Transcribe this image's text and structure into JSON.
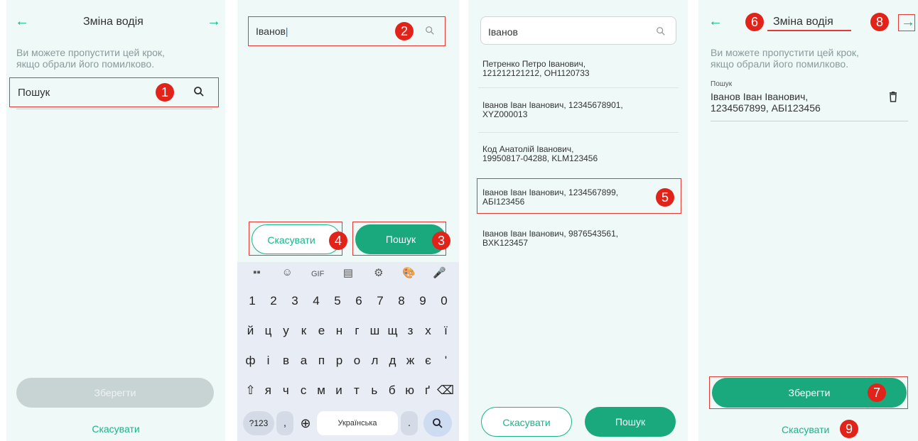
{
  "panel1": {
    "back_icon": "arrow-left-icon",
    "title": "Зміна водія",
    "next_icon": "arrow-right-icon",
    "hint_line1": "Ви можете пропустити цей крок,",
    "hint_line2": "якщо обрали його помилково.",
    "search_label": "Пошук",
    "save_label": "Зберегти",
    "cancel_label": "Скасувати",
    "badge": "1"
  },
  "panel2": {
    "search_value": "Іванов",
    "cancel_label": "Скасувати",
    "search_label": "Пошук",
    "badges": [
      "2",
      "3",
      "4"
    ],
    "keyboard": {
      "toolbar": [
        "▪▪",
        "☺",
        "GIF",
        "▤",
        "⚙",
        "🎨",
        "🎤"
      ],
      "row_digits": [
        "1",
        "2",
        "3",
        "4",
        "5",
        "6",
        "7",
        "8",
        "9",
        "0"
      ],
      "row1": [
        "й",
        "ц",
        "у",
        "к",
        "е",
        "н",
        "г",
        "ш",
        "щ",
        "з",
        "х",
        "ї"
      ],
      "row2": [
        "ф",
        "і",
        "в",
        "а",
        "п",
        "р",
        "о",
        "л",
        "д",
        "ж",
        "є",
        "'"
      ],
      "row3": [
        "я",
        "ч",
        "с",
        "м",
        "и",
        "т",
        "ь",
        "б",
        "ю",
        "ґ"
      ],
      "sym_label": "?123",
      "comma": ",",
      "space_label": "Українська",
      "period": "."
    }
  },
  "panel3": {
    "search_value": "Іванов",
    "results": [
      {
        "line1": "Петренко Петро Іванович,",
        "line2": "121212121212, ОН1120733"
      },
      {
        "line1": "Іванов Іван Іванович, 12345678901,",
        "line2": "XYZ000013"
      },
      {
        "line1": "Код Анатолій Іванович,",
        "line2": "19950817-04288, KLM123456"
      },
      {
        "line1": "Іванов Іван Іванович, 1234567899,",
        "line2": "АБІ123456"
      },
      {
        "line1": "Іванов Іван Іванович, 9876543561,",
        "line2": "BXK123457"
      }
    ],
    "cancel_label": "Скасувати",
    "search_label": "Пошук",
    "badge": "5"
  },
  "panel4": {
    "title": "Зміна водія",
    "hint_line1": "Ви можете пропустити цей крок,",
    "hint_line2": "якщо обрали його помилково.",
    "field_label": "Пошук",
    "field_value_line1": "Іванов Іван Іванович,",
    "field_value_line2": "1234567899, АБІ123456",
    "save_label": "Зберегти",
    "cancel_label": "Скасувати",
    "badges": [
      "6",
      "7",
      "8",
      "9"
    ]
  },
  "colors": {
    "accent": "#19b48c",
    "button": "#1aa87d",
    "panel_bg": "#eef9f8",
    "badge": "#e2231a",
    "highlight": "#e53935",
    "disabled": "#c8d4d4"
  }
}
